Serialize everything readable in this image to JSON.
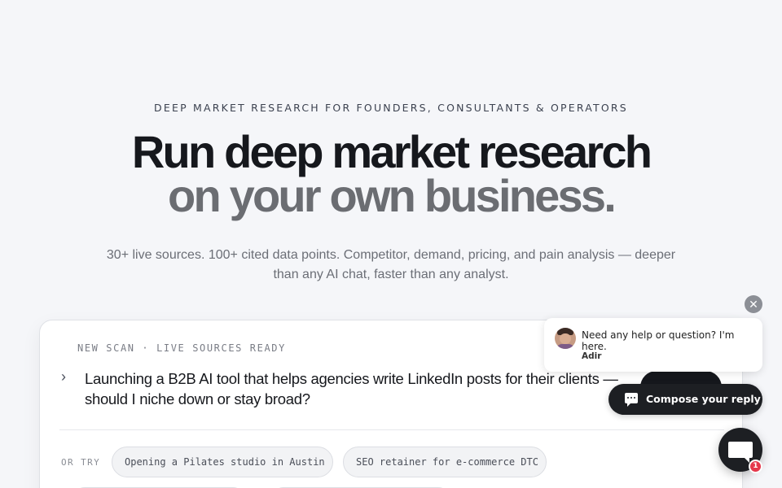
{
  "hero": {
    "eyebrow": "DEEP MARKET RESEARCH FOR FOUNDERS, CONSULTANTS & OPERATORS",
    "headline_line1": "Run deep market research",
    "headline_line2": "on your own business.",
    "subtitle": "30+ live sources. 100+ cited data points. Competitor, demand, pricing, and pain analysis — deeper than any AI chat, faster than any analyst."
  },
  "scan_card": {
    "label": "NEW SCAN · LIVE SOURCES READY",
    "prompt": "Launching a B2B AI tool that helps agencies write LinkedIn posts for their clients — should I niche down or stay broad?",
    "or_try_label": "OR TRY",
    "suggestions": [
      "Opening a Pilates studio in Austin",
      "SEO retainer for e-commerce DTC"
    ]
  },
  "chat_widget": {
    "popup_message": "Need any help or question? I'm here.",
    "agent_name": "Adir",
    "compose_label": "Compose your reply",
    "unread_count": "1"
  },
  "colors": {
    "background": "#f5f6f9",
    "headline_primary": "#16181d",
    "headline_secondary": "#6b6d72",
    "widget_dark": "#1d1f23",
    "badge_red": "#e5384c"
  }
}
